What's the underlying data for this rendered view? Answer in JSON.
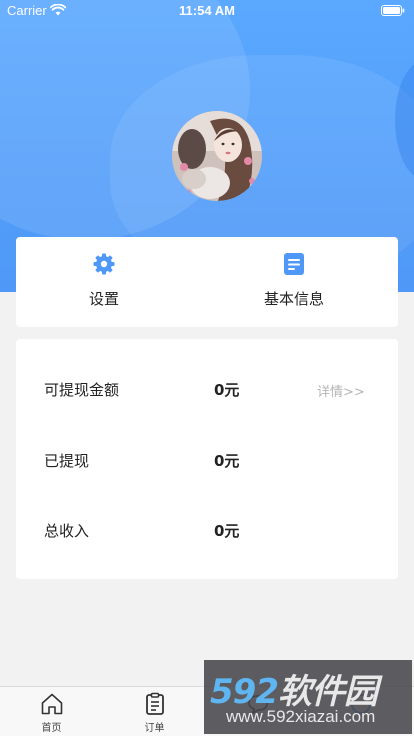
{
  "status_bar": {
    "carrier": "Carrier",
    "time": "11:54 AM"
  },
  "profile": {
    "avatar_alt": "avatar"
  },
  "actions": [
    {
      "label": "设置",
      "icon": "gear-icon"
    },
    {
      "label": "基本信息",
      "icon": "document-list-icon"
    }
  ],
  "earnings": {
    "withdrawable": {
      "label": "可提现金额",
      "value": "0元",
      "detail": "详情>>"
    },
    "withdrawn": {
      "label": "已提现",
      "value": "0元"
    },
    "total_income": {
      "label": "总收入",
      "value": "0元"
    }
  },
  "tabbar": [
    {
      "label": "首页",
      "icon": "home-icon"
    },
    {
      "label": "订单",
      "icon": "clipboard-icon"
    },
    {
      "label": "",
      "icon": "chat-icon"
    },
    {
      "label": "",
      "icon": "user-icon"
    }
  ],
  "watermark": {
    "logo_num": "592",
    "logo_text": "软件园",
    "url": "www.592xiazai.com"
  },
  "colors": {
    "primary": "#4f98f7",
    "background": "#f2f2f2",
    "card": "#ffffff"
  }
}
